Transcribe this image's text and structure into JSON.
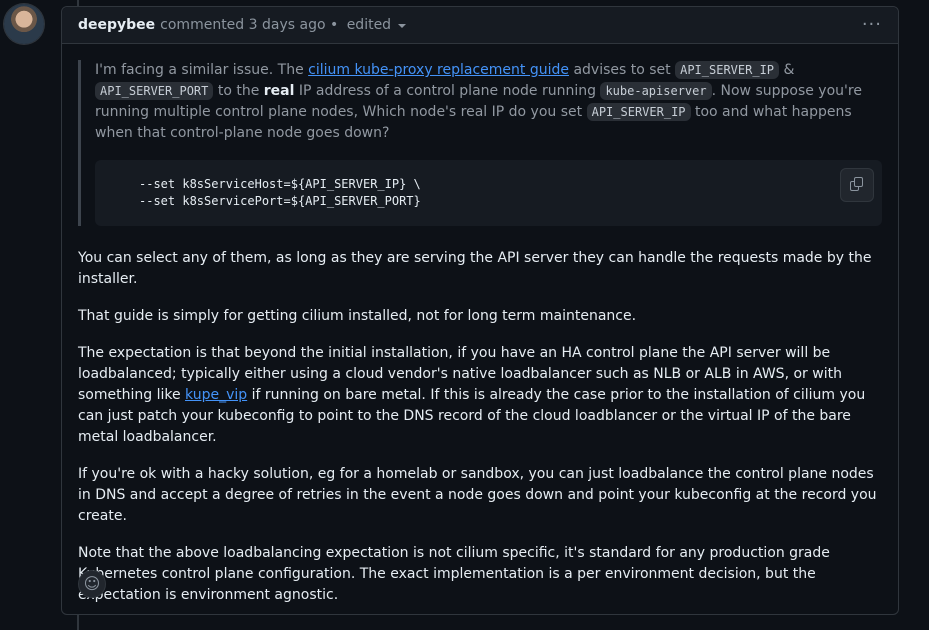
{
  "header": {
    "author": "deepybee",
    "meta_text": "commented 3 days ago • ",
    "edited_label": "edited",
    "more_label": "···"
  },
  "quote": {
    "p1_a": "I'm facing a similar issue. The ",
    "p1_link": "cilium kube-proxy replacement guide",
    "p1_b": " advises to set ",
    "p1_code1": "API_SERVER_IP",
    "p1_c": " & ",
    "p1_code2": "API_SERVER_PORT",
    "p1_d": " to the ",
    "p1_strong": "real",
    "p1_e": " IP address of a control plane node running ",
    "p1_code3": "kube-apiserver",
    "p1_f": ". Now suppose you're running multiple control plane nodes, Which node's real IP do you set ",
    "p1_code4": "API_SERVER_IP",
    "p1_g": " too and what happens when that control-plane node goes down?",
    "code_line1": "--set k8sServiceHost=${API_SERVER_IP} \\",
    "code_line2": "--set k8sServicePort=${API_SERVER_PORT}"
  },
  "body": {
    "p1": "You can select any of them, as long as they are serving the API server they can handle the requests made by the installer.",
    "p2": "That guide is simply for getting cilium installed, not for long term maintenance.",
    "p3_a": "The expectation is that beyond the initial installation, if you have an HA control plane the API server will be loadbalanced; typically either using a cloud vendor's native loadbalancer such as NLB or ALB in AWS, or with something like ",
    "p3_link": "kupe_vip",
    "p3_b": " if running on bare metal. If this is already the case prior to the installation of cilium you can just patch your kubeconfig to point to the DNS record of the cloud loadblancer or the virtual IP of the bare metal loadbalancer.",
    "p4": "If you're ok with a hacky solution, eg for a homelab or sandbox, you can just loadbalance the control plane nodes in DNS and accept a degree of retries in the event a node goes down and point your kubeconfig at the record you create.",
    "p5": "Note that the above loadbalancing expectation is not cilium specific, it's standard for any production grade Kubernetes control plane configuration. The exact implementation is a per environment decision, but the expectation is environment agnostic."
  },
  "reaction_icon": "☺",
  "colors": {
    "background": "#0d1117",
    "header": "#161b22",
    "border": "#30363d",
    "link": "#4493f8"
  }
}
